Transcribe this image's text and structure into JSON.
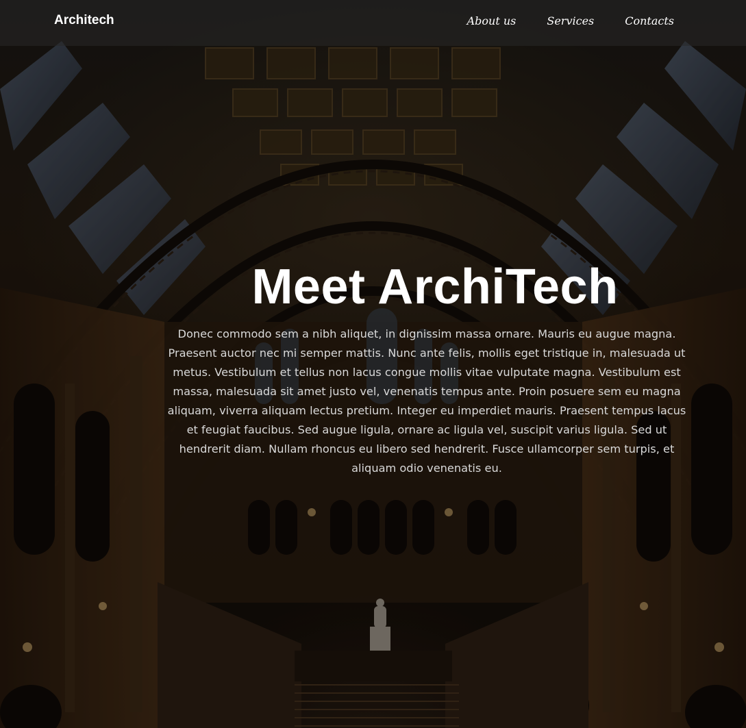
{
  "nav": {
    "brand": "Architech",
    "links": [
      "About us",
      "Services",
      "Contacts"
    ]
  },
  "hero": {
    "title": "Meet ArchiTech",
    "description": "Donec commodo sem a nibh aliquet, in dignissim massa ornare. Mauris eu augue magna. Praesent auctor nec mi semper mattis. Nunc ante felis, mollis eget tristique in, malesuada ut metus. Vestibulum et tellus non lacus congue mollis vitae vulputate magna. Vestibulum est massa, malesuada sit amet justo vel, venenatis tempus ante. Proin posuere sem eu magna aliquam, viverra aliquam lectus pretium. Integer eu imperdiet mauris. Praesent tempus lacus et feugiat faucibus. Sed augue ligula, ornare ac ligula vel, suscipit varius ligula. Sed ut hendrerit diam. Nullam rhoncus eu libero sed hendrerit. Fusce ullamcorper sem turpis, et aliquam odio venenatis eu."
  },
  "colors": {
    "navbar_bg": "#282828",
    "text_primary": "#ffffff",
    "text_secondary": "#d9d9d9"
  }
}
